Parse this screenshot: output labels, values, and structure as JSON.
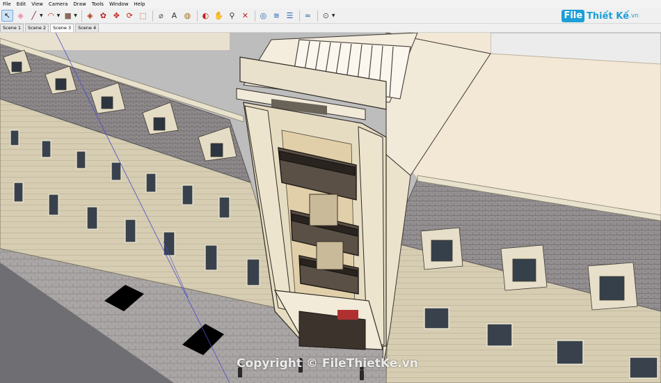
{
  "menubar": {
    "items": [
      "File",
      "Edit",
      "View",
      "Camera",
      "Draw",
      "Tools",
      "Window",
      "Help"
    ]
  },
  "toolbar": {
    "tools": [
      {
        "name": "select-tool-icon",
        "glyph": "↖",
        "color": "#1a1a1a",
        "active": true
      },
      {
        "name": "eraser-tool-icon",
        "glyph": "◆",
        "color": "#e8a0b8"
      },
      {
        "name": "line-tool-icon",
        "glyph": "╱",
        "color": "#7a2a2a",
        "dropdown": true
      },
      {
        "name": "arc-tool-icon",
        "glyph": "◠",
        "color": "#c03030",
        "dropdown": true
      },
      {
        "name": "shape-tool-icon",
        "glyph": "■",
        "color": "#8a6a5a",
        "dropdown": true
      },
      {
        "sep": true
      },
      {
        "name": "push-pull-tool-icon",
        "glyph": "◈",
        "color": "#b03020"
      },
      {
        "name": "offset-tool-icon",
        "glyph": "✿",
        "color": "#c02020"
      },
      {
        "name": "move-tool-icon",
        "glyph": "✥",
        "color": "#c02020"
      },
      {
        "name": "rotate-tool-icon",
        "glyph": "⟳",
        "color": "#c02020"
      },
      {
        "name": "scale-tool-icon",
        "glyph": "⬚",
        "color": "#b03020"
      },
      {
        "sep": true
      },
      {
        "name": "tape-measure-tool-icon",
        "glyph": "⌀",
        "color": "#555555"
      },
      {
        "name": "text-tool-icon",
        "glyph": "A",
        "color": "#333333"
      },
      {
        "name": "paint-bucket-tool-icon",
        "glyph": "◍",
        "color": "#a07020"
      },
      {
        "sep": true
      },
      {
        "name": "orbit-tool-icon",
        "glyph": "◐",
        "color": "#c02020"
      },
      {
        "name": "pan-tool-icon",
        "glyph": "✋",
        "color": "#c08030"
      },
      {
        "name": "zoom-tool-icon",
        "glyph": "⚲",
        "color": "#333333"
      },
      {
        "name": "zoom-extents-tool-icon",
        "glyph": "✕",
        "color": "#c02020"
      },
      {
        "sep": true
      },
      {
        "name": "warehouse-icon",
        "glyph": "◎",
        "color": "#1f5fa8"
      },
      {
        "name": "extension-warehouse-icon",
        "glyph": "≋",
        "color": "#1f5fa8"
      },
      {
        "name": "layer-tool-icon",
        "glyph": "☰",
        "color": "#1f5fa8"
      },
      {
        "sep": true
      },
      {
        "name": "extension-manager-icon",
        "glyph": "≈",
        "color": "#1f5fa8"
      },
      {
        "sep": true
      },
      {
        "name": "account-icon",
        "glyph": "⊙",
        "color": "#555555",
        "dropdown": true
      }
    ]
  },
  "logo": {
    "box": "File",
    "text": "Thiết Kế",
    "tld": ".vn"
  },
  "scenes": {
    "tabs": [
      "Scene 1",
      "Scene 2",
      "Scene 3",
      "Scene 4"
    ],
    "active": 2
  },
  "watermark": {
    "text": "Copyright © FileThietKe.vn"
  },
  "colors": {
    "roof_tile": "#8b8688",
    "facade": "#d8cfb4",
    "cobblestone": "#a9a5a4",
    "road": "#6c6c70",
    "neighbor_roof": "#f3e8d5",
    "background_box": "#ececec",
    "accent_blue": "#1b9fd8"
  }
}
